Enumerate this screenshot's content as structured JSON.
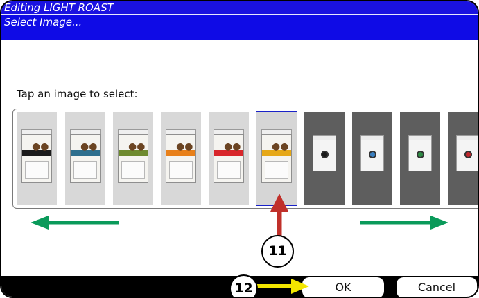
{
  "header": {
    "title": "Editing LIGHT ROAST",
    "subtitle": "Select Image..."
  },
  "prompt": "Tap an image to select:",
  "images": [
    {
      "style": "bag",
      "band_color": "#1a1a1a",
      "selected": false
    },
    {
      "style": "bag",
      "band_color": "#2e6f8e",
      "selected": false
    },
    {
      "style": "bag",
      "band_color": "#6e8a2e",
      "selected": false
    },
    {
      "style": "bag",
      "band_color": "#e8801a",
      "selected": false
    },
    {
      "style": "bag",
      "band_color": "#d8262b",
      "selected": false
    },
    {
      "style": "bag",
      "band_color": "#e6a817",
      "selected": true
    },
    {
      "style": "pod",
      "dot_color": "#1a1a1a",
      "selected": false
    },
    {
      "style": "pod",
      "dot_color": "#3a7fc0",
      "selected": false
    },
    {
      "style": "pod",
      "dot_color": "#2e8a44",
      "selected": false
    },
    {
      "style": "pod",
      "dot_color": "#c0272d",
      "selected": false
    }
  ],
  "buttons": {
    "ok": "OK",
    "cancel": "Cancel"
  },
  "callouts": {
    "select_step": "11",
    "ok_step": "12"
  },
  "colors": {
    "header": "#1a12e0",
    "scroll_arrows": "#0a9a5a",
    "pointer_arrow_select": "#c0302a",
    "pointer_arrow_ok": "#f3e600"
  }
}
